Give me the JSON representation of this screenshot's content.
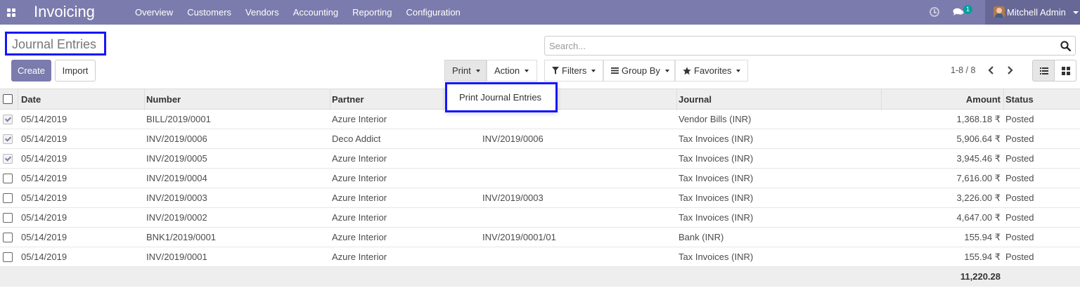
{
  "navbar": {
    "app_title": "Invoicing",
    "menu": [
      "Overview",
      "Customers",
      "Vendors",
      "Accounting",
      "Reporting",
      "Configuration"
    ],
    "chat_badge": "1",
    "user_name": "Mitchell Admin",
    "color": "#7c7bad"
  },
  "page": {
    "title": "Journal Entries",
    "create_label": "Create",
    "import_label": "Import"
  },
  "search": {
    "placeholder": "Search..."
  },
  "toolbar": {
    "print_label": "Print",
    "action_label": "Action",
    "filters_label": "Filters",
    "groupby_label": "Group By",
    "favorites_label": "Favorites"
  },
  "print_menu": {
    "items": [
      "Print Journal Entries"
    ]
  },
  "pager": {
    "value": "1-8 / 8"
  },
  "table": {
    "columns": [
      "Date",
      "Number",
      "Partner",
      "",
      "Journal",
      "Amount",
      "Status"
    ],
    "rows": [
      {
        "checked": true,
        "date": "05/14/2019",
        "number": "BILL/2019/0001",
        "partner": "Azure Interior",
        "reference": "",
        "journal": "Vendor Bills (INR)",
        "amount": "1,368.18 ₹",
        "status": "Posted"
      },
      {
        "checked": true,
        "date": "05/14/2019",
        "number": "INV/2019/0006",
        "partner": "Deco Addict",
        "reference": "INV/2019/0006",
        "journal": "Tax Invoices (INR)",
        "amount": "5,906.64 ₹",
        "status": "Posted"
      },
      {
        "checked": true,
        "date": "05/14/2019",
        "number": "INV/2019/0005",
        "partner": "Azure Interior",
        "reference": "",
        "journal": "Tax Invoices (INR)",
        "amount": "3,945.46 ₹",
        "status": "Posted"
      },
      {
        "checked": false,
        "date": "05/14/2019",
        "number": "INV/2019/0004",
        "partner": "Azure Interior",
        "reference": "",
        "journal": "Tax Invoices (INR)",
        "amount": "7,616.00 ₹",
        "status": "Posted"
      },
      {
        "checked": false,
        "date": "05/14/2019",
        "number": "INV/2019/0003",
        "partner": "Azure Interior",
        "reference": "INV/2019/0003",
        "journal": "Tax Invoices (INR)",
        "amount": "3,226.00 ₹",
        "status": "Posted"
      },
      {
        "checked": false,
        "date": "05/14/2019",
        "number": "INV/2019/0002",
        "partner": "Azure Interior",
        "reference": "",
        "journal": "Tax Invoices (INR)",
        "amount": "4,647.00 ₹",
        "status": "Posted"
      },
      {
        "checked": false,
        "date": "05/14/2019",
        "number": "BNK1/2019/0001",
        "partner": "Azure Interior",
        "reference": "INV/2019/0001/01",
        "journal": "Bank (INR)",
        "amount": "155.94 ₹",
        "status": "Posted"
      },
      {
        "checked": false,
        "date": "05/14/2019",
        "number": "INV/2019/0001",
        "partner": "Azure Interior",
        "reference": "",
        "journal": "Tax Invoices (INR)",
        "amount": "155.94 ₹",
        "status": "Posted"
      }
    ],
    "total_amount": "11,220.28"
  }
}
